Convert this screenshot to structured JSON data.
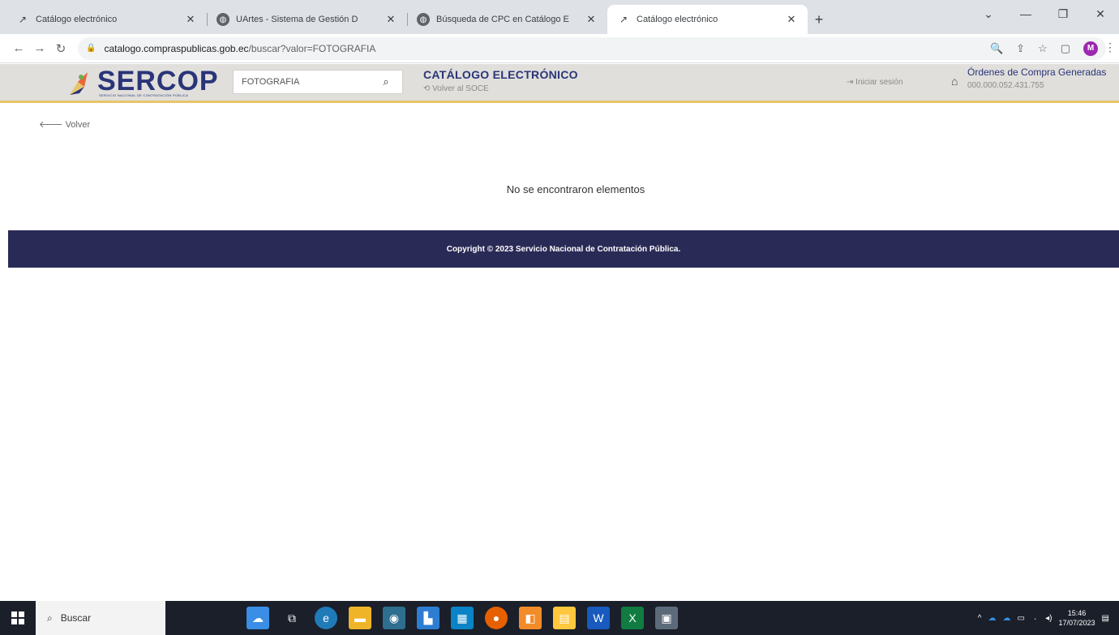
{
  "browser": {
    "tabs": [
      {
        "title": "Catálogo electrónico",
        "icon": "sercop-favicon",
        "active": false
      },
      {
        "title": "UArtes - Sistema de Gestión D",
        "icon": "globe-icon",
        "active": false
      },
      {
        "title": "Búsqueda de CPC en Catálogo E",
        "icon": "globe-icon",
        "active": false
      },
      {
        "title": "Catálogo electrónico",
        "icon": "sercop-favicon",
        "active": true
      }
    ],
    "url_host": "catalogo.compraspublicas.gob.ec",
    "url_path": "/buscar?valor=FOTOGRAFIA",
    "profile_initial": "M"
  },
  "header": {
    "logo_text": "SERCOP",
    "logo_subtitle": "SERVICIO NACIONAL DE CONTRATACIÓN PÚBLICA",
    "search_value": "FOTOGRAFIA",
    "catalog_title": "CATÁLOGO ELECTRÓNICO",
    "back_to_soce": "Volver al SOCE",
    "login_label": "Iniciar sesión",
    "orders_title": "Órdenes de Compra Generadas",
    "orders_amount": "000.000.052.431.755"
  },
  "main": {
    "back_label": "Volver",
    "empty_message": "No se encontraron elementos"
  },
  "footer": {
    "copyright": "Copyright © 2023 Servicio Nacional de Contratación Pública."
  },
  "taskbar": {
    "search_label": "Buscar",
    "time": "15:46",
    "date": "17/07/2023"
  },
  "colors": {
    "brand_blue": "#2a3478",
    "header_gold": "#e7c56a",
    "footer_bg": "#2a2a57"
  }
}
